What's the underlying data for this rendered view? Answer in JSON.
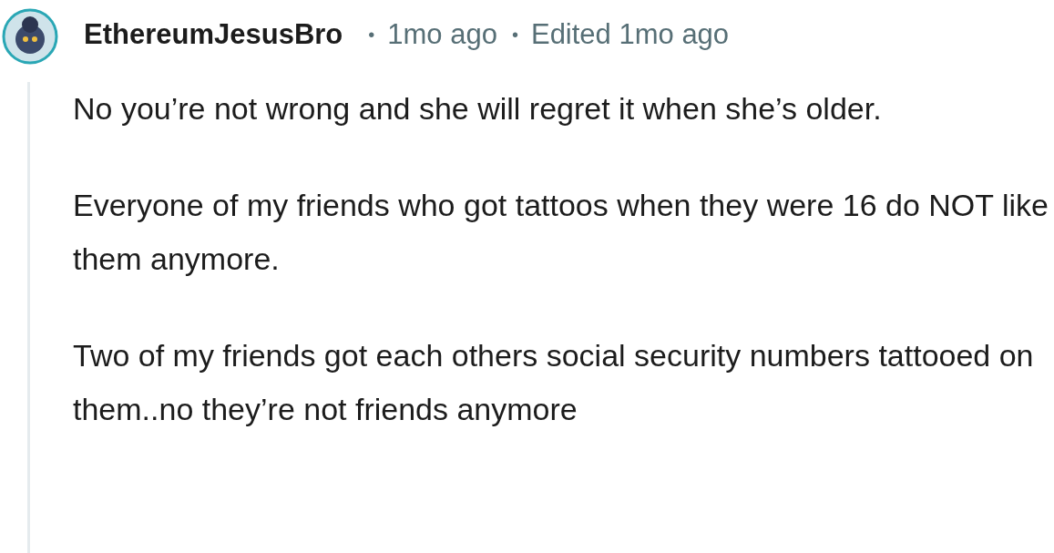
{
  "comment": {
    "author": "EthereumJesusBro",
    "separator_1": "•",
    "time": "1mo ago",
    "separator_2": "•",
    "edited": "Edited 1mo ago",
    "paragraphs": [
      "No you’re not wrong and she will regret it when she’s older.",
      "Everyone of my friends who got tattoos when they were 16 do NOT like them anymore.",
      "Two of my friends got each others social security numbers tattooed on them..no they’re not friends anymore"
    ]
  }
}
